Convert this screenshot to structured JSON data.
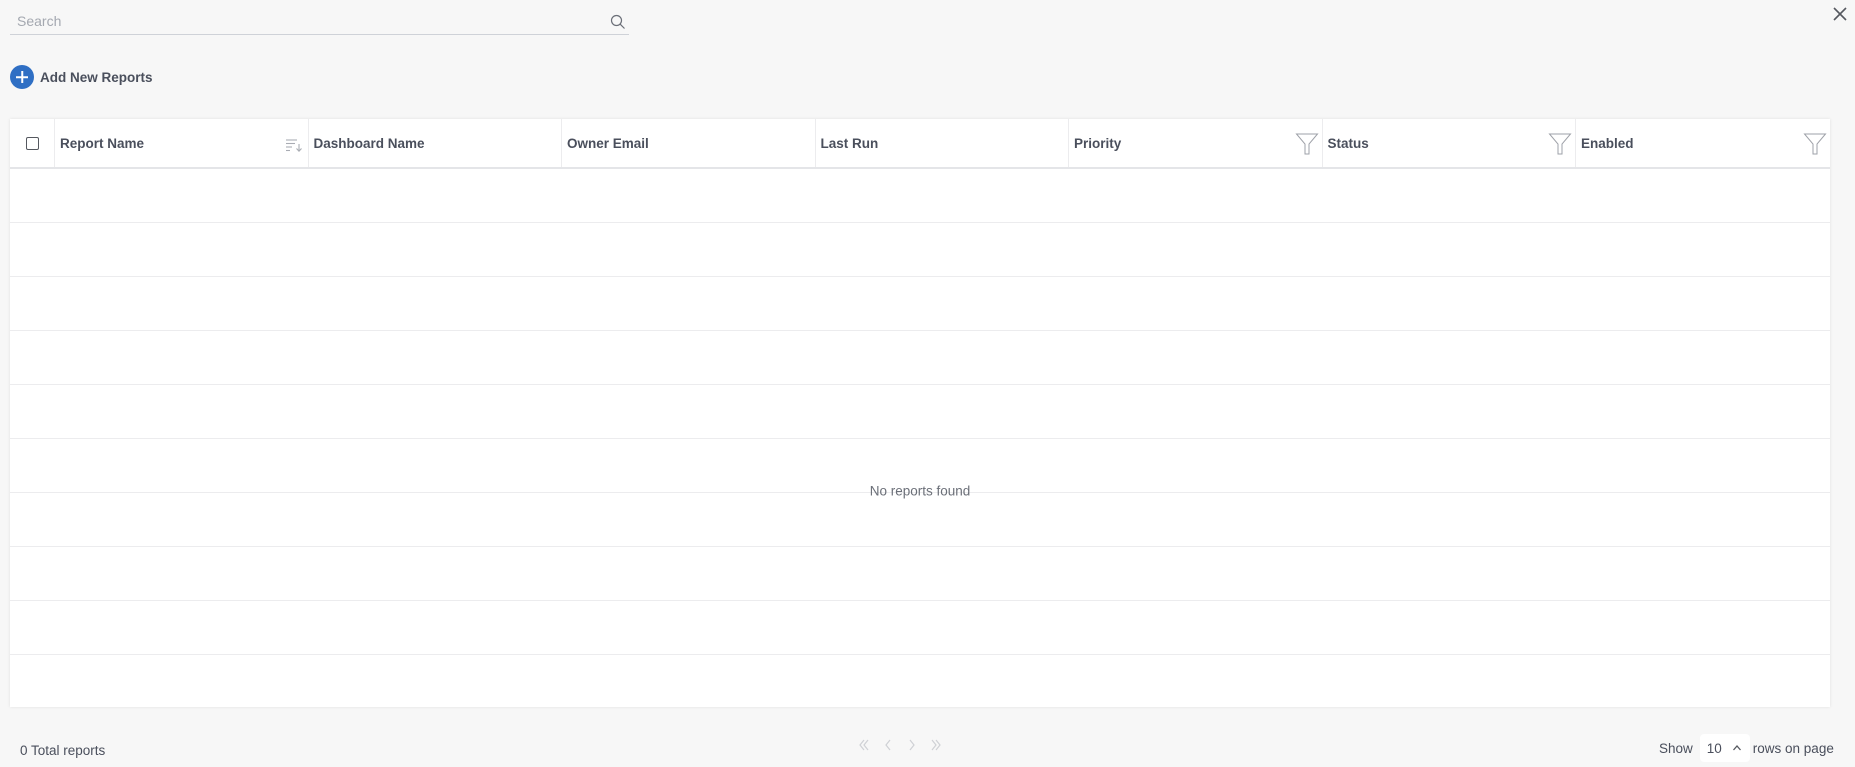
{
  "search": {
    "placeholder": "Search",
    "value": ""
  },
  "toolbar": {
    "add_label": "Add New Reports"
  },
  "table": {
    "columns": [
      {
        "label": "Report Name",
        "icon": "sort-icon"
      },
      {
        "label": "Dashboard Name",
        "icon": null
      },
      {
        "label": "Owner Email",
        "icon": null
      },
      {
        "label": "Last Run",
        "icon": null
      },
      {
        "label": "Priority",
        "icon": "filter-icon"
      },
      {
        "label": "Status",
        "icon": "filter-icon"
      },
      {
        "label": "Enabled",
        "icon": "filter-icon"
      }
    ],
    "rows": [],
    "empty_message": "No reports found"
  },
  "footer": {
    "total_label": "0 Total reports",
    "pagination": [
      "first-page",
      "previous-page",
      "next-page",
      "last-page"
    ],
    "show_label": "Show",
    "rows_per_page": "10",
    "rows_suffix": "rows on page"
  },
  "colors": {
    "accent": "#2f6fc4",
    "background": "#f7f7f7",
    "text": "#4a4f5c"
  }
}
